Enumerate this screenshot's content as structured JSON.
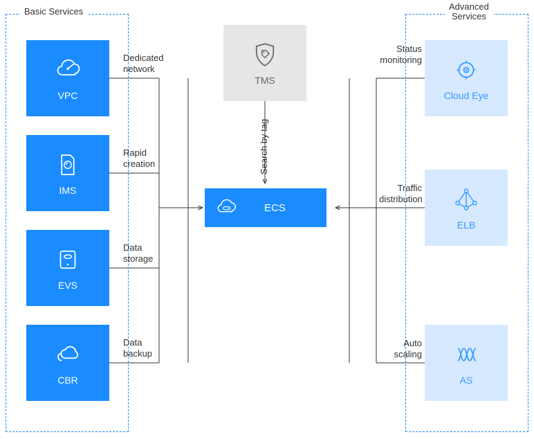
{
  "groups": {
    "basic": {
      "label": "Basic Services"
    },
    "advanced": {
      "label": "Advanced\nServices"
    }
  },
  "center": {
    "tms": {
      "label": "TMS",
      "edge": "Search by tag"
    },
    "ecs": {
      "label": "ECS"
    }
  },
  "basic_services": [
    {
      "key": "vpc",
      "label": "VPC",
      "edge": "Dedicated\nnetwork"
    },
    {
      "key": "ims",
      "label": "IMS",
      "edge": "Rapid\ncreation"
    },
    {
      "key": "evs",
      "label": "EVS",
      "edge": "Data\nstorage"
    },
    {
      "key": "cbr",
      "label": "CBR",
      "edge": "Data\nbackup"
    }
  ],
  "advanced_services": [
    {
      "key": "cloudeye",
      "label": "Cloud Eye",
      "edge": "Status\nmonitoring"
    },
    {
      "key": "elb",
      "label": "ELB",
      "edge": "Traffic\ndistribution"
    },
    {
      "key": "as",
      "label": "AS",
      "edge": "Auto\nscaling"
    }
  ],
  "colors": {
    "primary": "#1a8cff",
    "light": "#d6e9ff",
    "gray": "#e6e6e6"
  }
}
